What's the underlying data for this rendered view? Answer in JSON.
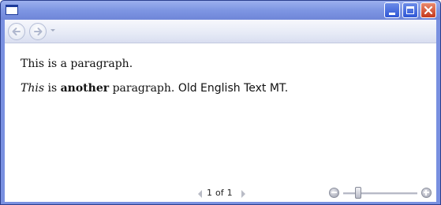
{
  "window": {
    "icon": "window-icon",
    "controls": {
      "minimize_icon": "minimize-icon",
      "maximize_icon": "maximize-icon",
      "close_icon": "close-icon"
    }
  },
  "navigation": {
    "back_icon": "back-arrow-icon",
    "forward_icon": "forward-arrow-icon"
  },
  "document": {
    "paragraph1": "This is a paragraph.",
    "paragraph2": {
      "italic": "This",
      "text1": " is ",
      "bold": "another",
      "text2": " paragraph. ",
      "font_text": "Old English Text MT."
    }
  },
  "status": {
    "page_current": "1",
    "page_of": "of",
    "page_total": "1",
    "zoom_level": 0.2
  },
  "colors": {
    "title_bar": "#7e96e3",
    "close_button": "#c5391d"
  }
}
